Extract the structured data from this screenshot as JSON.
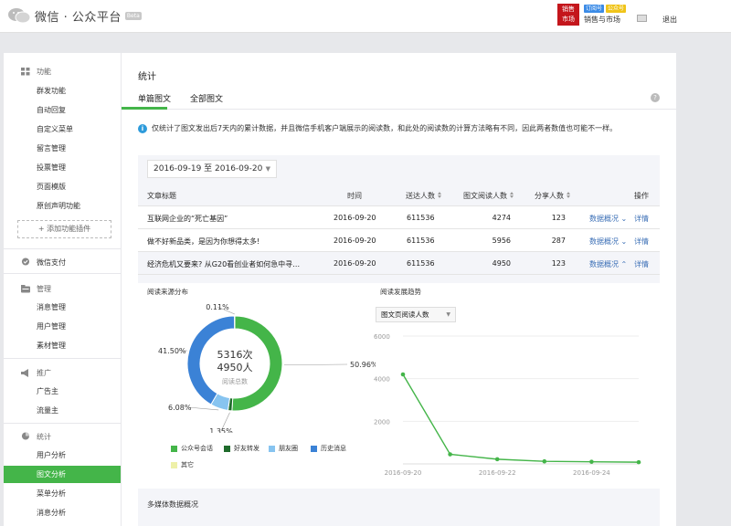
{
  "topbar": {
    "title": "微信 · 公众平台",
    "beta_label": "Beta",
    "account_name": "销售与市场",
    "avatar_text": "销售与市场",
    "tag_verified": "订阅号",
    "tag_type": "公众号",
    "logout_label": "退出"
  },
  "sidebar": {
    "groups": [
      {
        "title": "功能",
        "icon": "grid-icon",
        "items": [
          "群发功能",
          "自动回复",
          "自定义菜单",
          "留言管理",
          "投票管理",
          "页面模版",
          "原创声明功能"
        ]
      },
      {
        "title": "微信支付",
        "icon": "check-circle-icon",
        "items": []
      },
      {
        "title": "管理",
        "icon": "folder-icon",
        "items": [
          "消息管理",
          "用户管理",
          "素材管理"
        ]
      },
      {
        "title": "推广",
        "icon": "megaphone-icon",
        "items": [
          "广告主",
          "流量主"
        ]
      },
      {
        "title": "统计",
        "icon": "chart-icon",
        "items": [
          "用户分析",
          "图文分析",
          "菜单分析",
          "消息分析"
        ]
      }
    ],
    "add_plugin_label": "+ 添加功能插件",
    "active_item": "图文分析"
  },
  "main": {
    "title": "统计",
    "tabs": [
      "单篇图文",
      "全部图文"
    ],
    "active_tab": "单篇图文",
    "notice": "仅统计了图文发出后7天内的累计数据，并且微信手机客户端展示的阅读数，和此处的阅读数的计算方法略有不同，因此两者数值也可能不一样。",
    "date_range": "2016-09-19 至 2016-09-20",
    "table": {
      "headers": [
        "文章标题",
        "时间",
        "送达人数",
        "图文阅读人数",
        "分享人数",
        "操作"
      ],
      "rows": [
        {
          "title": "互联网企业的“死亡基因”",
          "date": "2016-09-20",
          "sent": "611536",
          "reads": "4274",
          "shares": "123",
          "action1": "数据概况",
          "action2": "详情"
        },
        {
          "title": "做不好新品类，是因为你想得太多!",
          "date": "2016-09-20",
          "sent": "611536",
          "reads": "5956",
          "shares": "287",
          "action1": "数据概况",
          "action2": "详情"
        },
        {
          "title": "经济危机又要来? 从G20看创业者如何急中寻…",
          "date": "2016-09-20",
          "sent": "611536",
          "reads": "4950",
          "shares": "123",
          "action1": "数据概况",
          "action2": "详情"
        }
      ]
    },
    "media_title": "多媒体数据概况"
  },
  "chart_data": [
    {
      "type": "pie",
      "title": "阅读来源分布",
      "center_line1": "5316次",
      "center_line2": "4950人",
      "center_caption": "阅读总数",
      "slices": [
        {
          "name": "公众号会话",
          "value": 50.96,
          "label": "50.96%",
          "color": "#44b549"
        },
        {
          "name": "好友转发",
          "value": 1.35,
          "label": "1.35%",
          "color": "#1f6b2c"
        },
        {
          "name": "朋友圈",
          "value": 6.08,
          "label": "6.08%",
          "color": "#87c4f0"
        },
        {
          "name": "历史消息",
          "value": 41.5,
          "label": "41.50%",
          "color": "#3b82d6"
        },
        {
          "name": "其它",
          "value": 0.11,
          "label": "0.11%",
          "color": "#eef0a8"
        }
      ]
    },
    {
      "type": "line",
      "title": "阅读发展趋势",
      "metric_select": "图文页阅读人数",
      "x": [
        "2016-09-20",
        "2016-09-21",
        "2016-09-22",
        "2016-09-23",
        "2016-09-24",
        "2016-09-25"
      ],
      "x_tick_labels": [
        "2016-09-20",
        "2016-09-22",
        "2016-09-24"
      ],
      "y_ticks": [
        "2000",
        "4000",
        "6000"
      ],
      "ylim": [
        0,
        6000
      ],
      "series": [
        {
          "values": [
            4200,
            450,
            220,
            120,
            100,
            80
          ],
          "color": "#44b549"
        }
      ]
    }
  ]
}
